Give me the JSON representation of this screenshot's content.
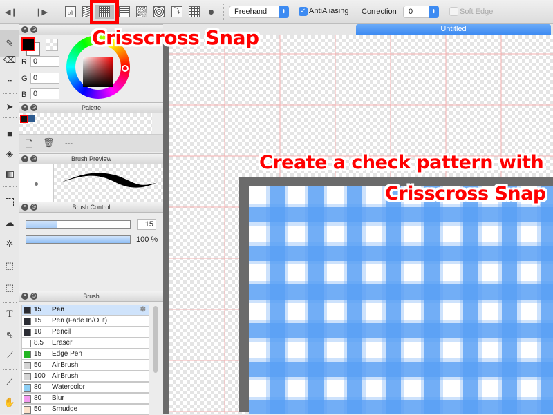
{
  "toolbar": {
    "nav_prev_icon": "step-back-icon",
    "nav_next_icon": "step-forward-icon",
    "snap_off_label": "off",
    "snap_buttons": [
      {
        "name": "snap-off",
        "icon": "snap-off-icon"
      },
      {
        "name": "parallel-snap",
        "icon": "parallel-lines-icon"
      },
      {
        "name": "crisscross-snap",
        "icon": "grid-icon",
        "active": true
      },
      {
        "name": "vanishing-point-snap",
        "icon": "vanishing-lines-icon"
      },
      {
        "name": "radial-snap",
        "icon": "radial-lines-icon"
      },
      {
        "name": "concentric-snap",
        "icon": "concentric-circles-icon"
      },
      {
        "name": "curve-snap",
        "icon": "curve-icon"
      },
      {
        "name": "perspective-snap",
        "icon": "perspective-grid-icon"
      },
      {
        "name": "brush-dot",
        "icon": "dot-icon"
      }
    ],
    "stroke_mode": "Freehand",
    "antialiasing_label": "AntiAliasing",
    "antialiasing_checked": true,
    "correction_label": "Correction",
    "correction_value": "0",
    "soft_edge_label": "Soft Edge",
    "soft_edge_checked": false
  },
  "document": {
    "tab_title": "Untitled"
  },
  "color_panel": {
    "r_label": "R",
    "r_value": "0",
    "g_label": "G",
    "g_value": "0",
    "b_label": "B",
    "b_value": "0",
    "foreground": "#000000"
  },
  "palette_panel": {
    "title": "Palette",
    "swatches": [
      "#111111",
      "#2d5b8f"
    ],
    "name_label": "---"
  },
  "brush_preview_panel": {
    "title": "Brush Preview"
  },
  "brush_control_panel": {
    "title": "Brush Control",
    "size_value": "15",
    "size_fraction": 0.3,
    "opacity_label": "100 %",
    "opacity_fraction": 1.0
  },
  "brush_panel": {
    "title": "Brush",
    "items": [
      {
        "size": "15",
        "name": "Pen",
        "color": "#2a2c33",
        "selected": true
      },
      {
        "size": "15",
        "name": "Pen (Fade In/Out)",
        "color": "#2a2c33"
      },
      {
        "size": "10",
        "name": "Pencil",
        "color": "#2a2c33"
      },
      {
        "size": "8.5",
        "name": "Eraser",
        "color": "#ffffff"
      },
      {
        "size": "15",
        "name": "Edge Pen",
        "color": "#22b522"
      },
      {
        "size": "50",
        "name": "AirBrush",
        "color": "#d4d4d4"
      },
      {
        "size": "100",
        "name": "AirBrush",
        "color": "#d4d4d4"
      },
      {
        "size": "80",
        "name": "Watercolor",
        "color": "#8fd0f5"
      },
      {
        "size": "80",
        "name": "Blur",
        "color": "#f49cf0"
      },
      {
        "size": "50",
        "name": "Smudge",
        "color": "#fbe3cc"
      }
    ]
  },
  "annotations": {
    "top_callout": "Crisscross Snap",
    "canvas_callout_line1": "Create a check pattern with",
    "canvas_callout_line2": "Crisscross Snap"
  },
  "colors": {
    "accent": "#3d8bf2",
    "highlight": "#ff0000",
    "pattern_blue": "#5aa0f5"
  }
}
